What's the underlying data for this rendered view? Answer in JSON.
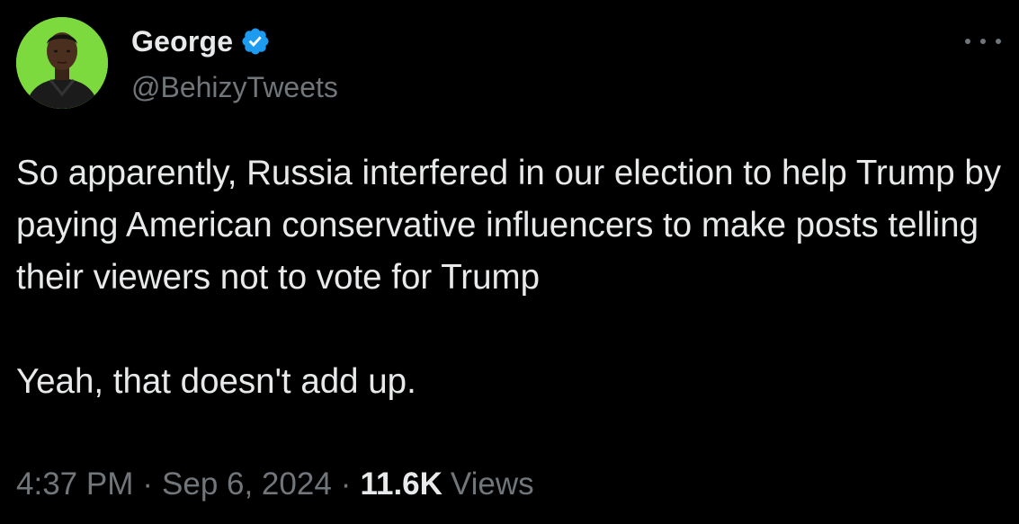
{
  "author": {
    "display_name": "George",
    "handle": "@BehizyTweets",
    "verified": true,
    "avatar_bg": "#7cd93e",
    "badge_color": "#1d9bf0"
  },
  "tweet": {
    "paragraphs": [
      "So apparently, Russia interfered in our election to help Trump by paying American conservative influencers to make posts telling their viewers not to vote for Trump",
      "Yeah, that doesn't add up."
    ]
  },
  "meta": {
    "time": "4:37 PM",
    "separator": "·",
    "date": "Sep 6, 2024",
    "views_count": "11.6K",
    "views_label": "Views"
  },
  "icons": {
    "verified": "verified-badge-icon",
    "more": "more-horizontal-icon"
  },
  "colors": {
    "background": "#000000",
    "primary_text": "#e7e9ea",
    "secondary_text": "#71767b"
  }
}
